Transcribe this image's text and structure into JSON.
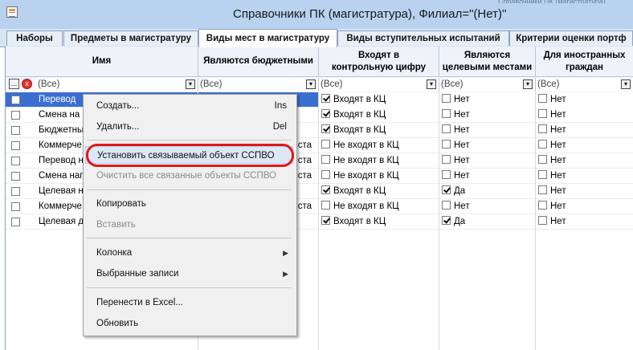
{
  "window": {
    "title": "Справочники ПК (магистратура), Филиал=\"(Нет)\"",
    "title_tail": "Справочники ПК (магистратура)"
  },
  "tabs": [
    {
      "label": "Наборы"
    },
    {
      "label": "Предметы в магистратуру"
    },
    {
      "label": "Виды мест в магистратуру"
    },
    {
      "label": "Виды вступительных испытаний"
    },
    {
      "label": "Критерии оценки портф"
    }
  ],
  "columns": [
    {
      "label": "Имя"
    },
    {
      "label": "Являются бюджетными"
    },
    {
      "label": "Входят в контрольную цифру"
    },
    {
      "label": "Являются целевыми местами"
    },
    {
      "label": "Для иностранных граждан"
    }
  ],
  "filters": {
    "all": "(Все)",
    "dots": "...",
    "clear": "x",
    "arrow": "▾"
  },
  "rows": [
    {
      "name": "Перевод",
      "budget": "",
      "kc": "Входят в КЦ",
      "kc_on": true,
      "target": "Нет",
      "target_on": false,
      "foreign": "Нет"
    },
    {
      "name": "Смена на",
      "budget": "",
      "kc": "Входят в КЦ",
      "kc_on": true,
      "target": "Нет",
      "target_on": false,
      "foreign": "Нет"
    },
    {
      "name": "Бюджетны",
      "budget": "",
      "kc": "Входят в КЦ",
      "kc_on": true,
      "target": "Нет",
      "target_on": false,
      "foreign": "Нет"
    },
    {
      "name": "Коммерче",
      "budget": "ста",
      "kc": "Не входят в КЦ",
      "kc_on": false,
      "target": "Нет",
      "target_on": false,
      "foreign": "Нет"
    },
    {
      "name": "Перевод н",
      "budget": "ста",
      "kc": "Не входят в КЦ",
      "kc_on": false,
      "target": "Нет",
      "target_on": false,
      "foreign": "Нет"
    },
    {
      "name": "Смена нап",
      "budget": "ста",
      "kc": "Не входят в КЦ",
      "kc_on": false,
      "target": "Нет",
      "target_on": false,
      "foreign": "Нет"
    },
    {
      "name": "Целевая н",
      "budget": "",
      "kc": "Входят в КЦ",
      "kc_on": true,
      "target": "Да",
      "target_on": true,
      "foreign": "Нет"
    },
    {
      "name": "Коммерче",
      "budget": "ста",
      "kc": "Не входят в КЦ",
      "kc_on": false,
      "target": "Нет",
      "target_on": false,
      "foreign": "Нет"
    },
    {
      "name": "Целевая д",
      "budget": "",
      "kc": "Входят в КЦ",
      "kc_on": true,
      "target": "Да",
      "target_on": true,
      "foreign": "Нет"
    }
  ],
  "context_menu": {
    "create": "Создать...",
    "create_sc": "Ins",
    "delete": "Удалить...",
    "delete_sc": "Del",
    "set_object": "Установить связываемый объект ССПВО",
    "clear_objects": "Очистить все связанные объекты ССПВО",
    "copy": "Копировать",
    "paste": "Вставить",
    "column": "Колонка",
    "selected": "Выбранные записи",
    "export": "Перенести в Excel...",
    "refresh": "Обновить",
    "submenu_arrow": "▶"
  },
  "colors": {
    "selection": "#3a6fd0",
    "highlight_circle": "#e01818",
    "titlebar": "#b8d2f0"
  }
}
